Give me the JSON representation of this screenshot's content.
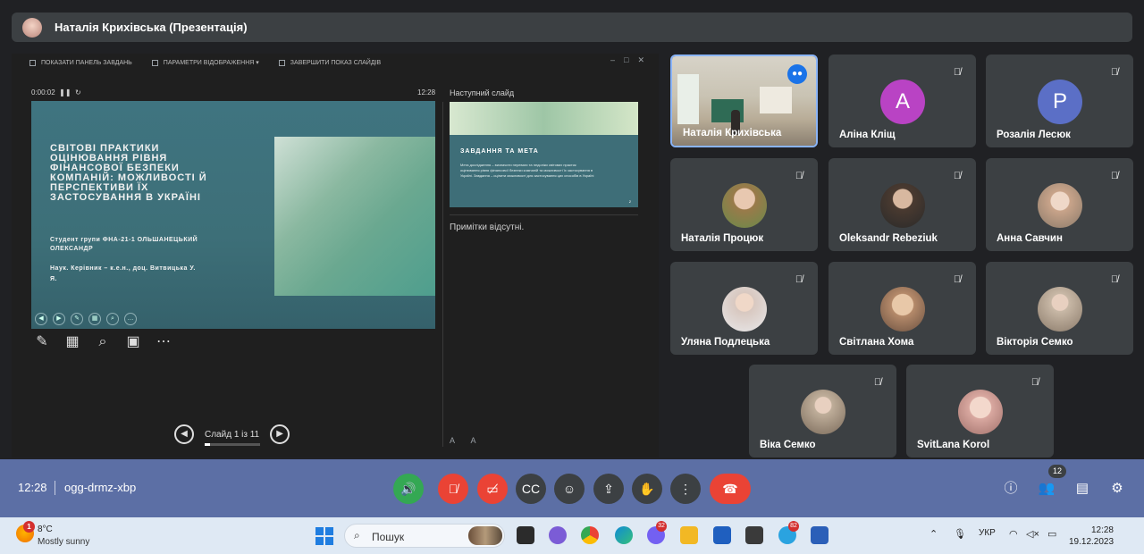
{
  "presenter_bar": {
    "title": "Наталія Крихівська (Презентація)"
  },
  "presentation": {
    "toolbar": [
      "ПОКАЗАТИ ПАНЕЛЬ ЗАВДАНЬ",
      "ПАРАМЕТРИ ВІДОБРАЖЕННЯ ▾",
      "ЗАВЕРШИТИ ПОКАЗ СЛАЙДІВ"
    ],
    "timer": "0:00:02",
    "clock": "12:28",
    "next_slide_label": "Наступний слайд",
    "slide": {
      "title": "СВІТОВІ ПРАКТИКИ ОЦІНЮВАННЯ РІВНЯ ФІНАНСОВОЇ БЕЗПЕКИ КОМПАНІЙ: МОЖЛИВОСТІ Й ПЕРСПЕКТИВИ ЇХ ЗАСТОСУВАННЯ В УКРАЇНІ",
      "student": "Студент групи ФНА-21-1 ОЛЬШАНЕЦЬКИЙ ОЛЕКСАНДР",
      "supervisor": "Наук. Керівник – к.е.н., доц. Витвицька У. Я."
    },
    "next_slide": {
      "title": "ЗАВДАННЯ ТА МЕТА",
      "body": "Мета дослідження – визначити переваги та недоліки світових практик оцінювання рівня фінансової безпеки компаній та можливості їх застосування в Україні. Завдання – оцінити можливості для застосування цих способів в Україні",
      "num": "2"
    },
    "notes": "Примітки відсутні.",
    "slide_counter": "Слайд 1 із 11"
  },
  "participants": [
    {
      "name": "Наталія Крихівська",
      "type": "video",
      "speaking": true
    },
    {
      "name": "Аліна Кліщ",
      "type": "letter",
      "letter": "A",
      "color": "#b943c4"
    },
    {
      "name": "Розалія Лесюк",
      "type": "letter",
      "letter": "P",
      "color": "#5b6fc6"
    },
    {
      "name": "Наталія Процюк",
      "type": "photo",
      "color": "#9a7a4a"
    },
    {
      "name": "Oleksandr Rebeziuk",
      "type": "photo",
      "color": "#4a3a30"
    },
    {
      "name": "Анна Савчин",
      "type": "photo",
      "color": "#c9a48a"
    },
    {
      "name": "Уляна Подлецька",
      "type": "photo",
      "color": "#d8c8c0"
    },
    {
      "name": "Світлана Хома",
      "type": "photo",
      "color": "#b58a6a"
    },
    {
      "name": "Вікторія Семко",
      "type": "photo",
      "color": "#c8b8a6"
    },
    {
      "name": "Віка Семко",
      "type": "photo",
      "color": "#bfae9a"
    },
    {
      "name": "SvitLana Korol",
      "type": "photo",
      "color": "#d9a8a0"
    }
  ],
  "meeting": {
    "time": "12:28",
    "code": "ogg-drmz-xbp",
    "participant_count": "12"
  },
  "taskbar": {
    "temperature": "8°C",
    "weather": "Mostly sunny",
    "weather_badge": "1",
    "search_placeholder": "Пошук",
    "viber_badge": "32",
    "telegram_badge": "82",
    "lang": "УКР",
    "clock_time": "12:28",
    "clock_date": "19.12.2023"
  }
}
